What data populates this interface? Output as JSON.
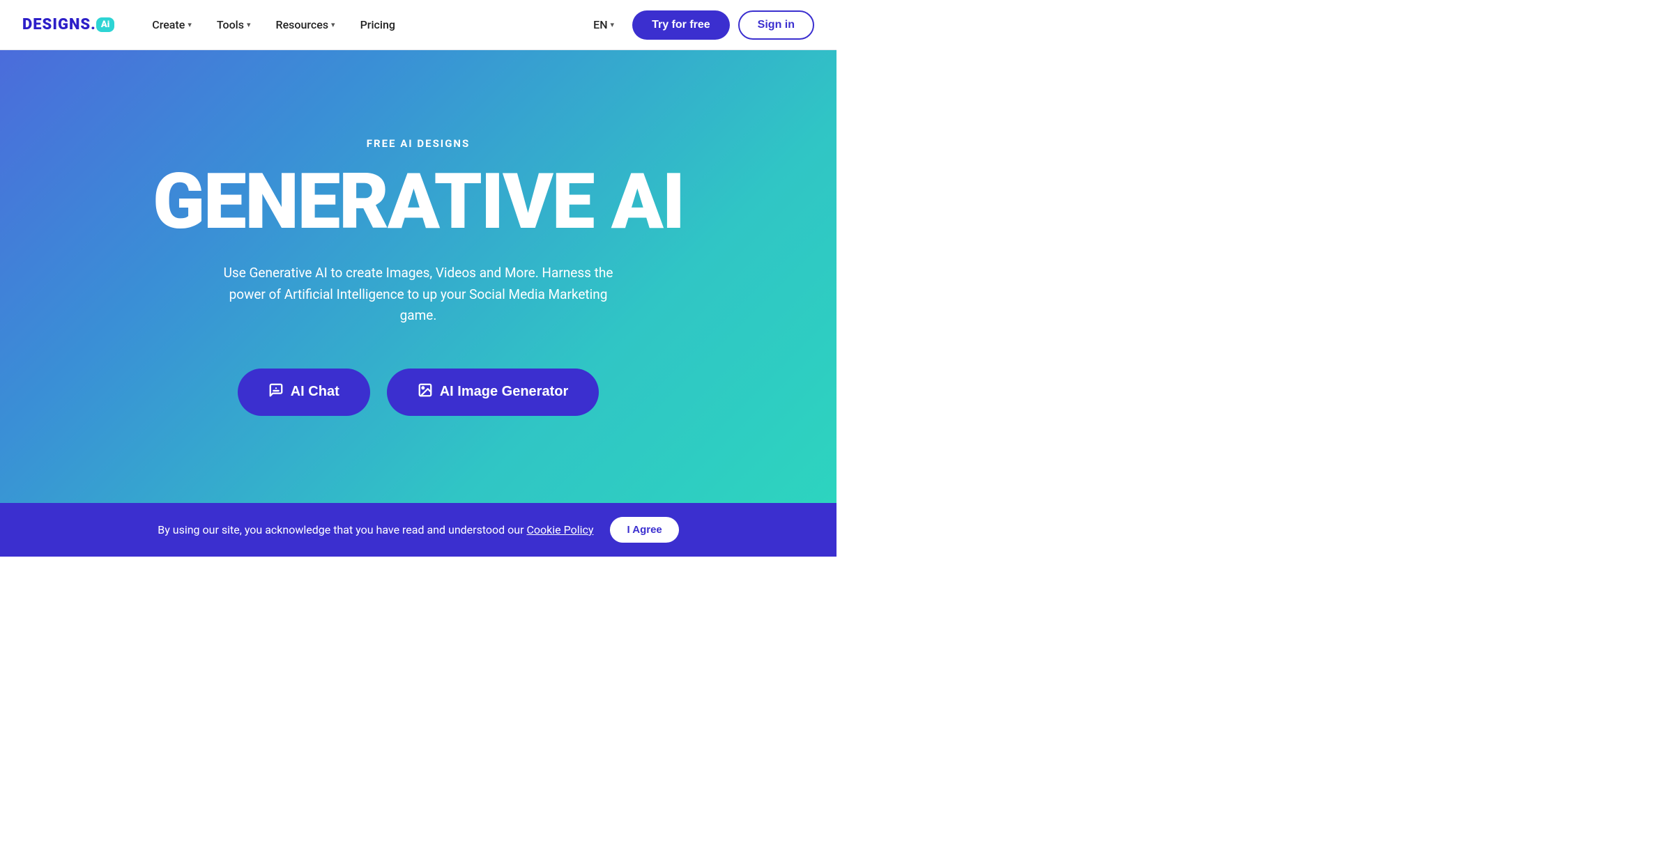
{
  "navbar": {
    "logo_text": "DESIGNS.",
    "logo_badge": "Ai",
    "nav_items": [
      {
        "label": "Create",
        "has_dropdown": true
      },
      {
        "label": "Tools",
        "has_dropdown": true
      },
      {
        "label": "Resources",
        "has_dropdown": true
      },
      {
        "label": "Pricing",
        "has_dropdown": false
      }
    ],
    "lang": "EN",
    "try_free_label": "Try for free",
    "sign_in_label": "Sign in"
  },
  "hero": {
    "eyebrow": "FREE AI DESIGNS",
    "title": "GENERATIVE AI",
    "subtitle": "Use Generative AI to create Images, Videos and More. Harness the power of Artificial Intelligence to up your Social Media Marketing game.",
    "btn_chat_label": "AI Chat",
    "btn_image_label": "AI Image Generator"
  },
  "cookie": {
    "text": "By using our site, you acknowledge that you have read and understood our",
    "link_text": "Cookie Policy",
    "agree_label": "I Agree"
  },
  "colors": {
    "brand_blue": "#3b2fcf",
    "brand_teal": "#2dd4d4",
    "hero_gradient_start": "#4b6cdb",
    "hero_gradient_end": "#2dd4bf"
  }
}
